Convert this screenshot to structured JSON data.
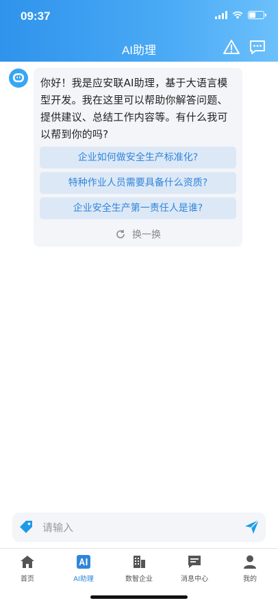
{
  "status_bar": {
    "time": "09:37"
  },
  "header": {
    "title": "AI助理",
    "warning_icon": "warning-triangle-icon",
    "chat_icon": "chat-bubble-icon",
    "colors": {
      "gradient_start": "#2f93ec",
      "gradient_end": "#6cc0fb"
    }
  },
  "chat": {
    "bot_message": "你好！我是应安联AI助理，基于大语言模型开发。我在这里可以帮助你解答问题、提供建议、总结工作内容等。有什么我可以帮到你的吗?",
    "suggestions": [
      {
        "label": "企业如何做安全生产标准化?"
      },
      {
        "label": "特种作业人员需要具备什么资质?"
      },
      {
        "label": "企业安全生产第一责任人是谁?"
      }
    ],
    "refresh_label": "换一换"
  },
  "input": {
    "placeholder": "请输入",
    "value": ""
  },
  "tabbar": {
    "items": [
      {
        "label": "首页",
        "icon": "home-icon",
        "active": false
      },
      {
        "label": "AI助理",
        "icon": "ai-icon",
        "active": true
      },
      {
        "label": "数智企业",
        "icon": "building-icon",
        "active": false
      },
      {
        "label": "消息中心",
        "icon": "message-icon",
        "active": false
      },
      {
        "label": "我的",
        "icon": "user-icon",
        "active": false
      }
    ],
    "accent_color": "#2f86d9"
  }
}
